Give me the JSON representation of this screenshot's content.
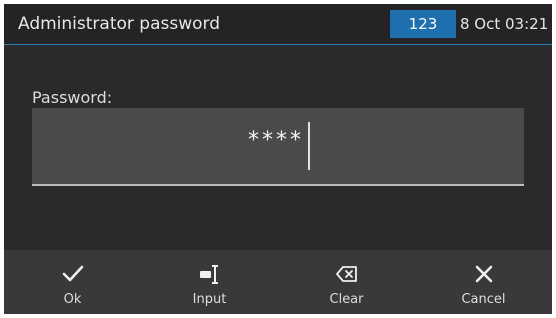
{
  "header": {
    "title": "Administrator password",
    "badge": "123",
    "datetime": "8 Oct 03:21",
    "accent_color": "#1e6fb0"
  },
  "password": {
    "label": "Password:",
    "masked_value": "****"
  },
  "toolbar": {
    "ok": {
      "label": "Ok",
      "icon": "checkmark-icon"
    },
    "input": {
      "label": "Input",
      "icon": "input-cursor-icon"
    },
    "clear": {
      "label": "Clear",
      "icon": "backspace-icon"
    },
    "cancel": {
      "label": "Cancel",
      "icon": "close-icon"
    }
  }
}
